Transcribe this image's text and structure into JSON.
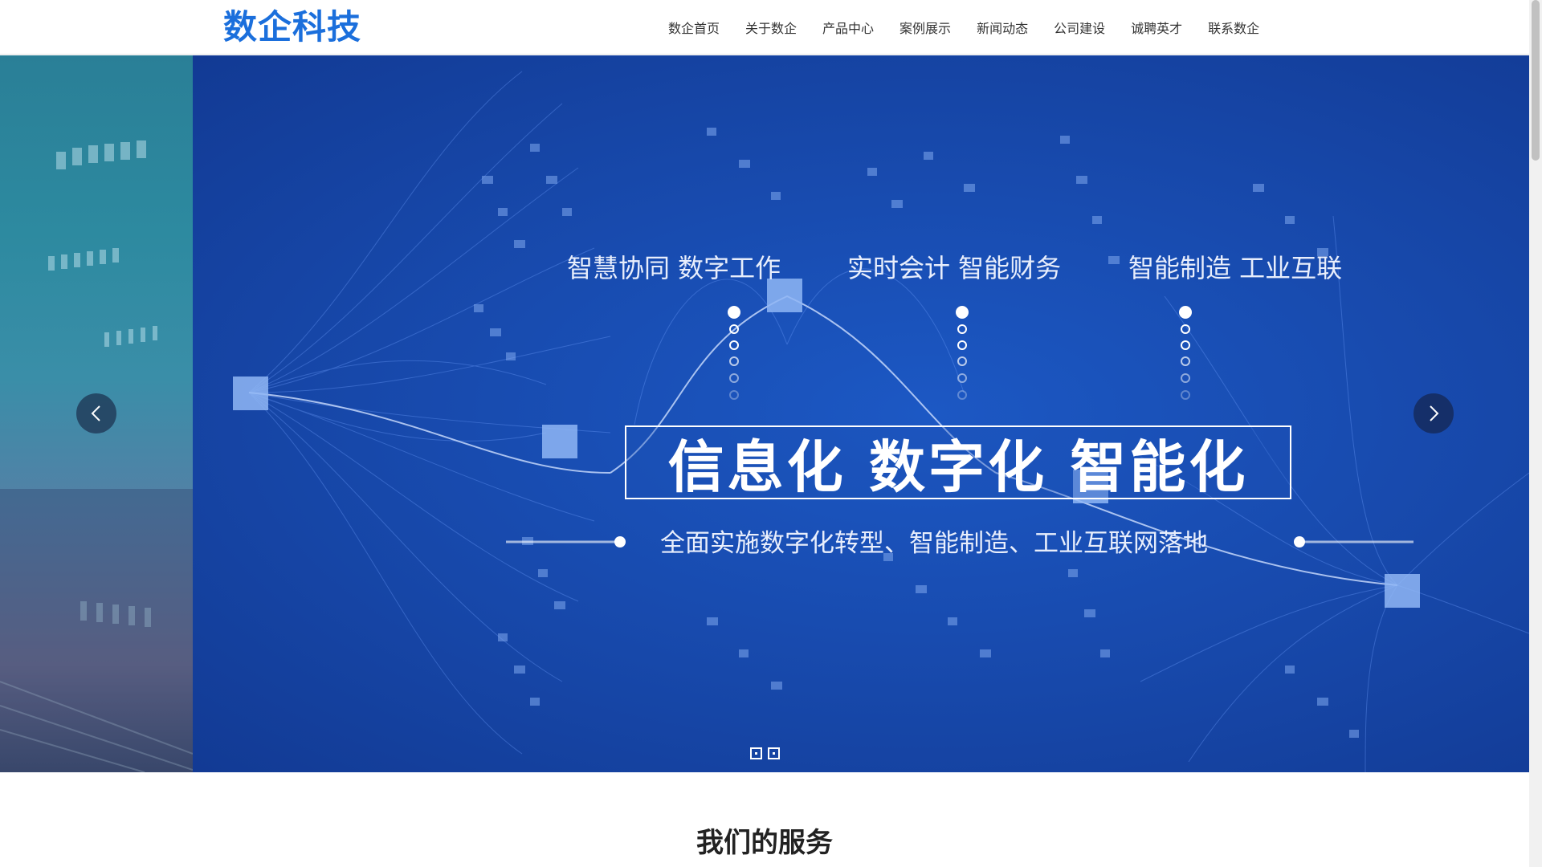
{
  "header": {
    "logo": "数企科技",
    "nav": [
      "数企首页",
      "关于数企",
      "产品中心",
      "案例展示",
      "新闻动态",
      "公司建设",
      "诚聘英才",
      "联系数企"
    ]
  },
  "banner": {
    "taglines": [
      "智慧协同 数字工作",
      "实时会计 智能财务",
      "智能制造 工业互联"
    ],
    "headline": "信息化  数字化  智能化",
    "subline": "全面实施数字化转型、智能制造、工业互联网落地",
    "prev_icon": "chevron-left-icon",
    "next_icon": "chevron-right-icon",
    "slide_count": 2,
    "colors": {
      "banner_blue": "#1748aa",
      "accent": "#1b6fdc"
    }
  },
  "section": {
    "title": "我们的服务"
  }
}
